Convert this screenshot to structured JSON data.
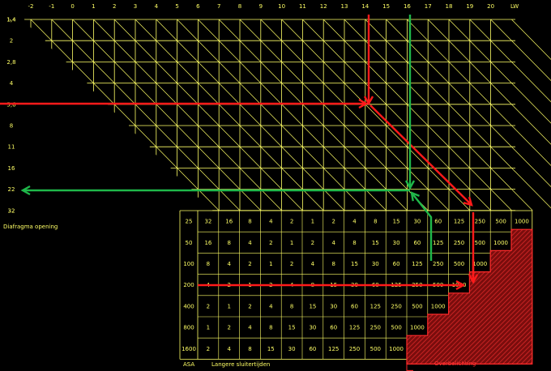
{
  "colors": {
    "background": "#000000",
    "grid": "#ffff66",
    "text": "#ffff66",
    "arrow_red": "#ff1a1a",
    "arrow_green": "#1fb84a",
    "overexposure_hatch": "#cc2222"
  },
  "lw_axis": {
    "label": "LW",
    "values": [
      "-2",
      "-1",
      "0",
      "1",
      "2",
      "3",
      "4",
      "5",
      "6",
      "7",
      "8",
      "9",
      "10",
      "11",
      "12",
      "13",
      "14",
      "15",
      "16",
      "17",
      "18",
      "19",
      "20"
    ]
  },
  "aperture_axis": {
    "label": "Diafragma opening",
    "values": [
      "1,4",
      "2",
      "2,8",
      "4",
      "5,6",
      "8",
      "11",
      "16",
      "22",
      "32"
    ]
  },
  "table": {
    "asa_label": "ASA",
    "shutter_label": "Langere sluitertijden",
    "overexposure_label": "Overbelichting",
    "asa_values": [
      "25",
      "50",
      "100",
      "200",
      "400",
      "800",
      "1600"
    ],
    "rows": [
      [
        "32",
        "16",
        "8",
        "4",
        "2",
        "1",
        "2",
        "4",
        "8",
        "15",
        "30",
        "60",
        "125",
        "250",
        "500",
        "1000"
      ],
      [
        "16",
        "8",
        "4",
        "2",
        "1",
        "2",
        "4",
        "8",
        "15",
        "30",
        "60",
        "125",
        "250",
        "500",
        "1000"
      ],
      [
        "8",
        "4",
        "2",
        "1",
        "2",
        "4",
        "8",
        "15",
        "30",
        "60",
        "125",
        "250",
        "500",
        "1000"
      ],
      [
        "4",
        "2",
        "1",
        "2",
        "4",
        "8",
        "15",
        "30",
        "60",
        "125",
        "250",
        "500",
        "1000"
      ],
      [
        "2",
        "1",
        "2",
        "4",
        "8",
        "15",
        "30",
        "60",
        "125",
        "250",
        "500",
        "1000"
      ],
      [
        "1",
        "2",
        "4",
        "8",
        "15",
        "30",
        "60",
        "125",
        "250",
        "500",
        "1000"
      ],
      [
        "2",
        "4",
        "8",
        "15",
        "30",
        "60",
        "125",
        "250",
        "500",
        "1000"
      ]
    ]
  }
}
